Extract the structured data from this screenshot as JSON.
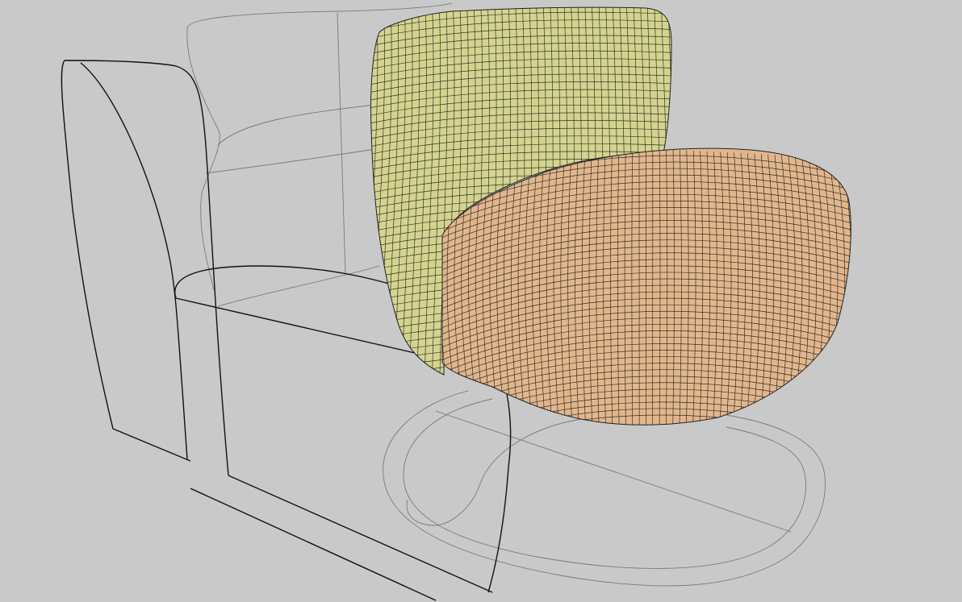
{
  "scene": {
    "background": "#c9c9c9",
    "subject": "armchair-wireframe-model",
    "surfaces": [
      {
        "name": "backrest",
        "color": "#d4d48f",
        "render": "quad-mesh"
      },
      {
        "name": "seat-cushion",
        "color": "#e2b68c",
        "render": "quad-mesh"
      }
    ],
    "curve_colors": {
      "construction": "#7a7a7a",
      "profile": "#111111",
      "mesh": "#1a1a1a"
    }
  }
}
